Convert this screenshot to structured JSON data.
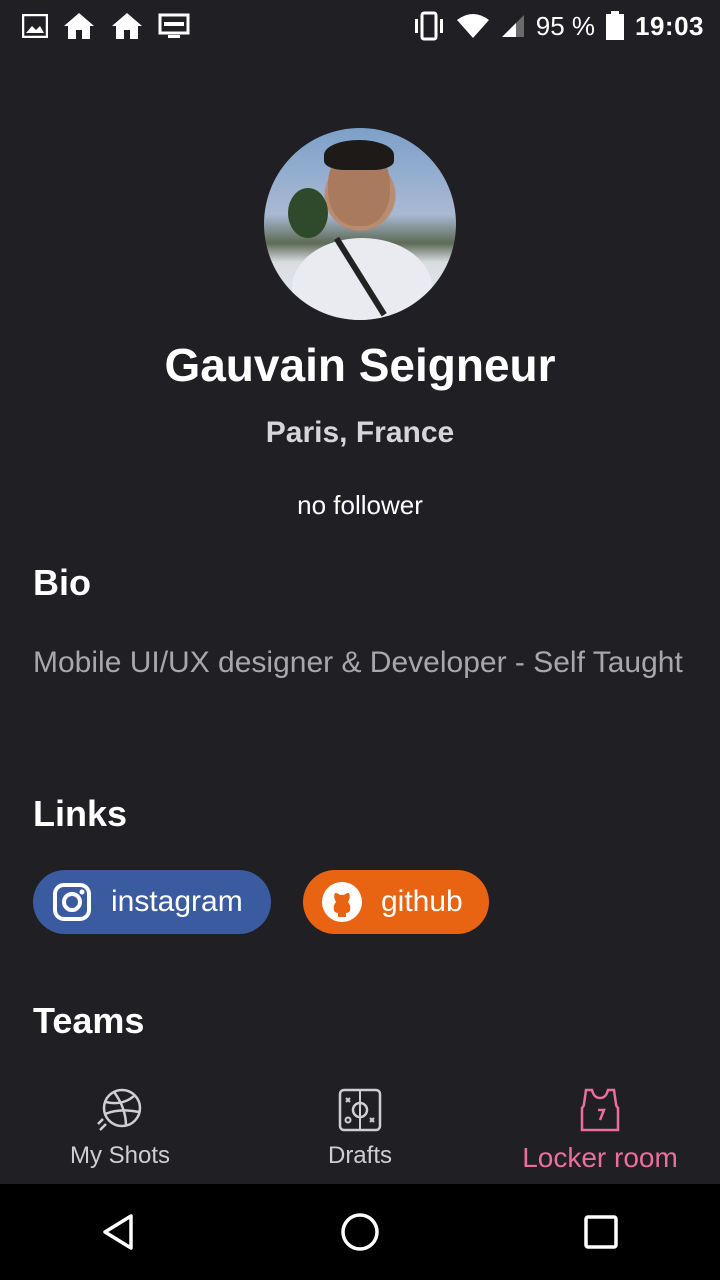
{
  "status_bar": {
    "battery_percent": "95 %",
    "time": "19:03",
    "icons": [
      "gallery-icon",
      "home-icon",
      "home-icon",
      "cast-icon",
      "vibrate-icon",
      "wifi-icon",
      "cell-signal-icon",
      "battery-icon"
    ]
  },
  "profile": {
    "name": "Gauvain Seigneur",
    "location": "Paris, France",
    "followers": "no follower"
  },
  "bio": {
    "title": "Bio",
    "text": "Mobile UI/UX designer & Developer - Self Taught"
  },
  "links": {
    "title": "Links",
    "items": [
      {
        "label": "instagram",
        "icon": "instagram-icon",
        "color": "#3b5ba0"
      },
      {
        "label": "github",
        "icon": "github-icon",
        "color": "#e86412"
      }
    ]
  },
  "teams": {
    "title": "Teams"
  },
  "bottom_nav": {
    "items": [
      {
        "label": "My Shots",
        "icon": "dribbble-ball-icon"
      },
      {
        "label": "Drafts",
        "icon": "drafts-board-icon"
      },
      {
        "label": "Locker room",
        "icon": "jersey-icon",
        "active": true
      }
    ],
    "active_color": "#ec6e9a"
  },
  "system_nav": {
    "icons": [
      "back-icon",
      "home-circle-icon",
      "recents-icon"
    ]
  }
}
